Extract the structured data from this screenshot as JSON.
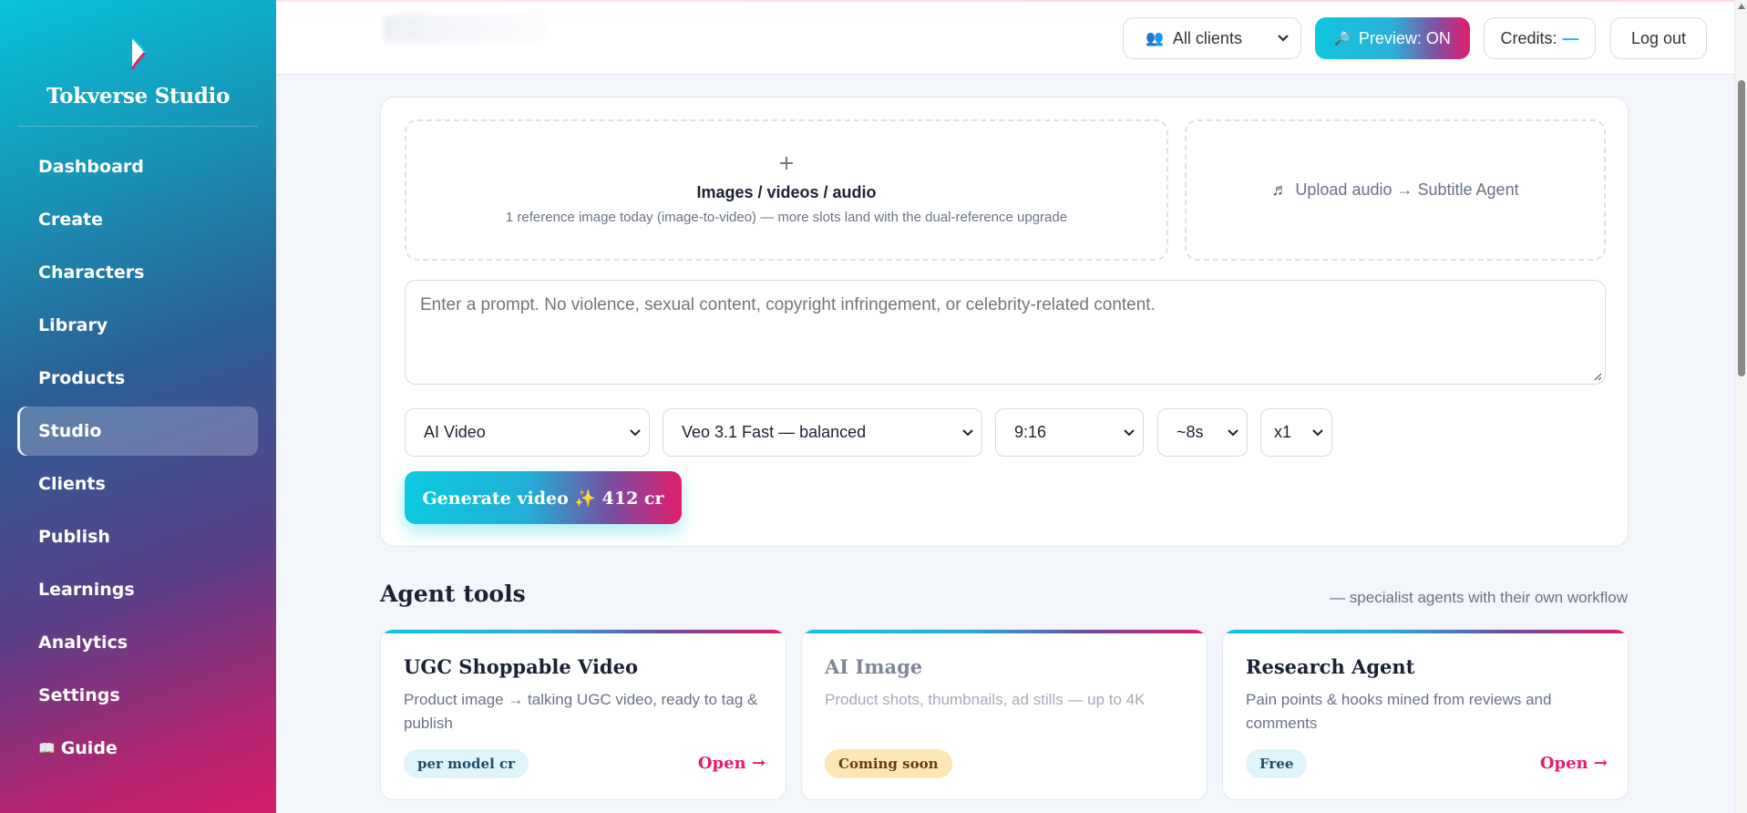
{
  "sidebar": {
    "brand": "Tokverse Studio",
    "items": [
      {
        "label": "Dashboard"
      },
      {
        "label": "Create"
      },
      {
        "label": "Characters"
      },
      {
        "label": "Library"
      },
      {
        "label": "Products"
      },
      {
        "label": "Studio",
        "active": true
      },
      {
        "label": "Clients"
      },
      {
        "label": "Publish"
      },
      {
        "label": "Learnings"
      },
      {
        "label": "Analytics"
      },
      {
        "label": "Settings"
      },
      {
        "label": "Guide",
        "icon": "book-icon"
      }
    ]
  },
  "topbar": {
    "client_select": "All clients",
    "preview_label": "Preview: ON",
    "credits_label": "Credits:",
    "credits_value": "—",
    "logout_label": "Log out"
  },
  "composer": {
    "upload": {
      "plus": "+",
      "title": "Images / videos / audio",
      "subtitle": "1 reference image today (image-to-video) — more slots land with the dual-reference upgrade"
    },
    "audio_upload": "Upload audio → Subtitle Agent",
    "prompt_placeholder": "Enter a prompt. No violence, sexual content, copyright infringement, or celebrity-related content.",
    "selects": {
      "mode": "AI Video",
      "model": "Veo 3.1 Fast — balanced",
      "aspect": "9:16",
      "duration": "~8s",
      "count": "x1"
    },
    "generate_label": "Generate video ✨ 412 cr"
  },
  "agent_tools": {
    "title": "Agent tools",
    "note": "— specialist agents with their own workflow",
    "cards": [
      {
        "title": "UGC Shoppable Video",
        "desc": "Product image → talking UGC video, ready to tag & publish",
        "badge": "per model cr",
        "link": "Open →"
      },
      {
        "title": "AI Image",
        "desc": "Product shots, thumbnails, ad stills — up to 4K",
        "badge": "Coming soon"
      },
      {
        "title": "Research Agent",
        "desc": "Pain points & hooks mined from reviews and comments",
        "badge": "Free",
        "link": "Open →"
      }
    ]
  },
  "colors": {
    "accent_cyan": "#10c6df",
    "accent_magenta": "#e01f6d",
    "link": "#e21e6d"
  }
}
